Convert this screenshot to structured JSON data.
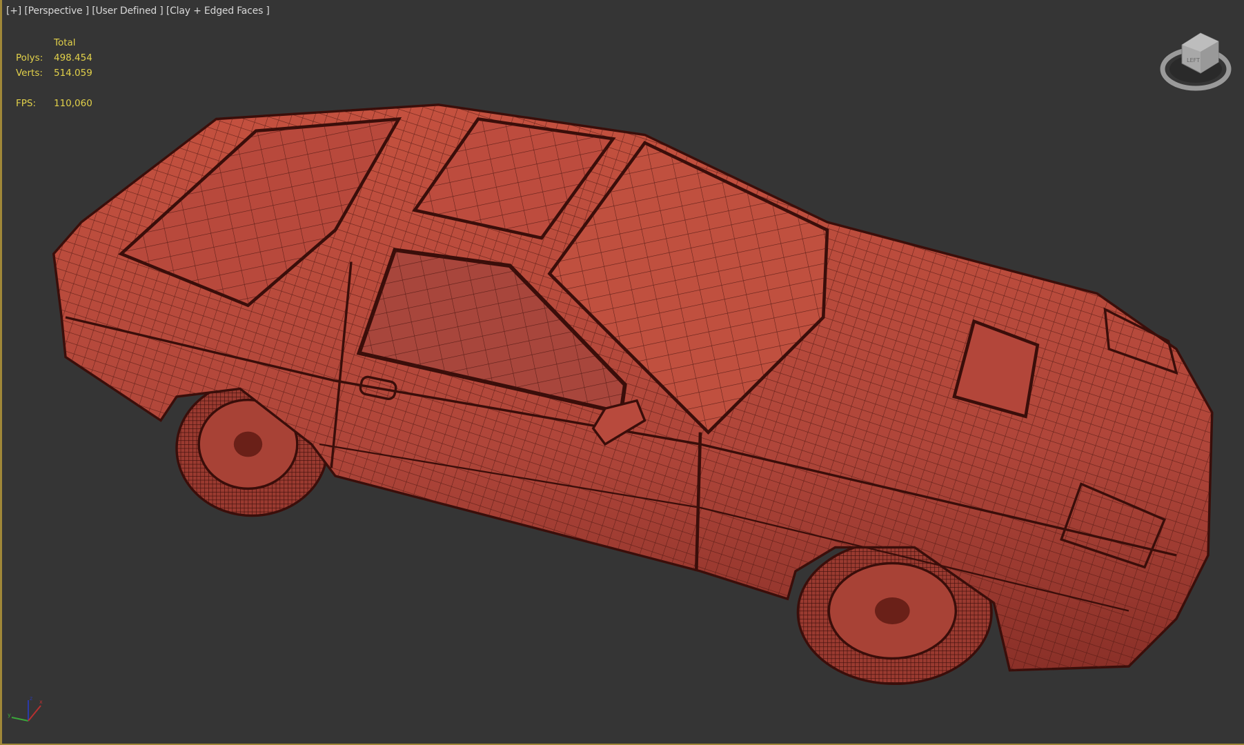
{
  "viewport": {
    "labels": [
      "[+]",
      "[Perspective ]",
      "[User Defined ]",
      "[Clay + Edged Faces ]"
    ],
    "stats": {
      "header": "Total",
      "polys_label": "Polys:",
      "polys": "498.454",
      "verts_label": "Verts:",
      "verts": "514.059",
      "fps_label": "FPS:",
      "fps": "110,060"
    },
    "viewcube": {
      "face_label": "LEFT"
    },
    "colors": {
      "background": "#353535",
      "clay": "#b9473a",
      "wire": "#4a1510",
      "stats_text": "#e2d14a",
      "active_border": "#a08838"
    }
  }
}
